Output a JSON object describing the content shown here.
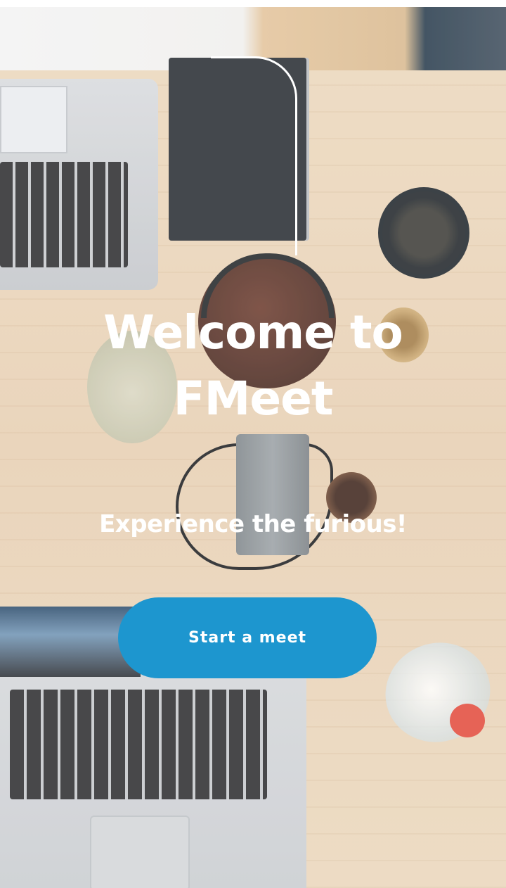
{
  "welcome": {
    "title_line1": "Welcome to",
    "title_line2": "FMeet",
    "tagline": "Experience the furious!"
  },
  "actions": {
    "start_label": "Start a meet"
  },
  "theme": {
    "accent": "#1d96cf",
    "text": "#ffffff"
  }
}
